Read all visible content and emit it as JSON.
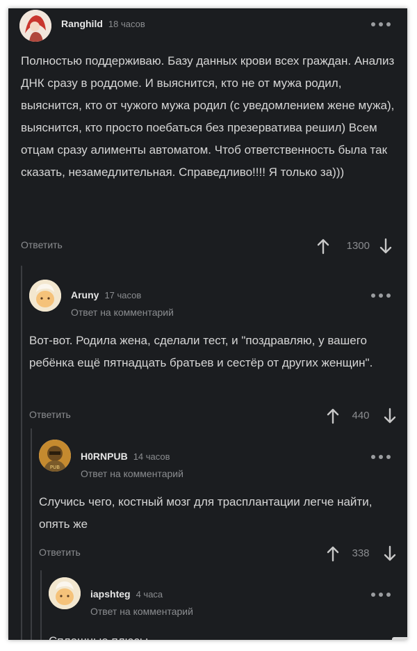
{
  "comments": [
    {
      "author": "Ranghild",
      "time": "18 часов",
      "text": "Полностью поддерживаю. Базу данных крови всех граждан. Анализ ДНК сразу в роддоме. И выяснится, кто не от мужа родил, выяснится, кто от чужого мужа родил (с уведомлением жене мужа), выяснится, кто просто поебаться без презерватива решил) Всем отцам сразу алименты автоматом. Чтоб ответственность была так сказать, незамедлительная. Справедливо!!!! Я только за)))",
      "reply_label": "Ответить",
      "score": "1300"
    },
    {
      "author": "Aruny",
      "time": "17 часов",
      "reply_to": "Ответ на комментарий",
      "text": "Вот-вот. Родила жена, сделали тест, и \"поздравляю, у вашего ребёнка ещё пятнадцать братьев и сестёр от других женщин\".",
      "reply_label": "Ответить",
      "score": "440"
    },
    {
      "author": "H0RNPUB",
      "time": "14 часов",
      "reply_to": "Ответ на комментарий",
      "text": "Случись чего, костный мозг для трасплантации легче найти, опять же",
      "reply_label": "Ответить",
      "score": "338"
    },
    {
      "author": "iapshteg",
      "time": "4 часа",
      "reply_to": "Ответ на комментарий",
      "text": "Сплошные плюсы"
    }
  ],
  "icons": {
    "more": "more-dots-icon",
    "up": "arrow-up-icon",
    "down": "arrow-down-icon"
  },
  "colors": {
    "background": "#1b1d20",
    "text": "#d6d6d6",
    "muted": "#8b8d90",
    "thread_line": "#3b3d41"
  }
}
